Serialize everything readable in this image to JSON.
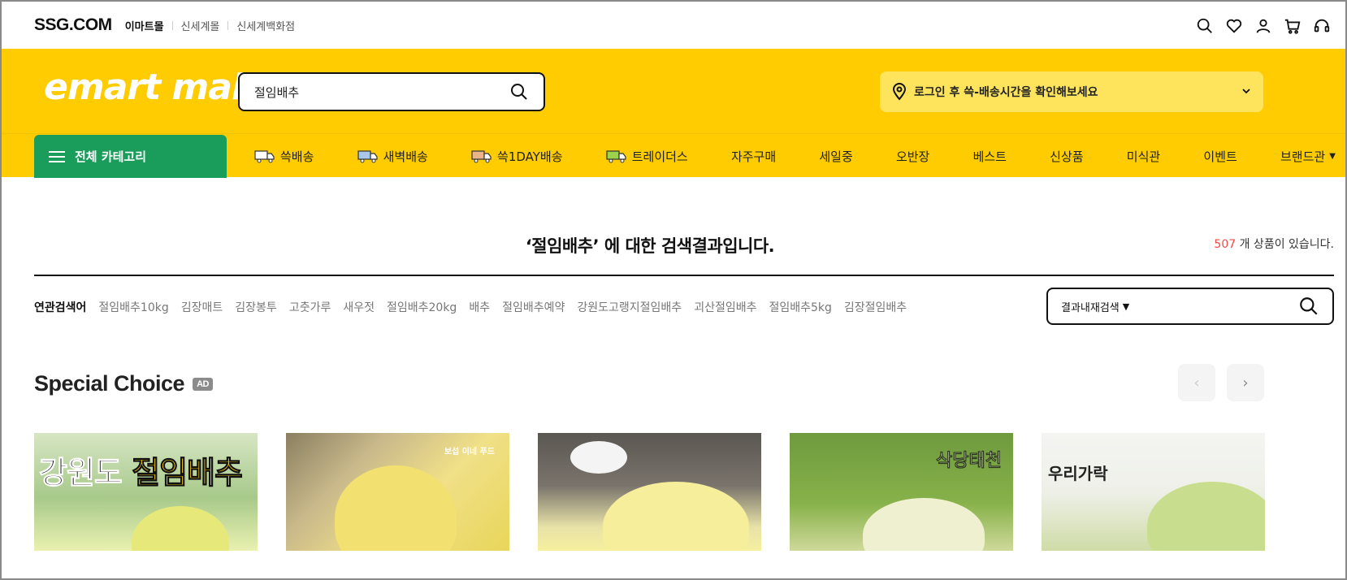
{
  "topbar": {
    "logo": "SSG.COM",
    "malls": [
      "이마트몰",
      "신세계몰",
      "신세계백화점"
    ],
    "icons": [
      "search-icon",
      "heart-icon",
      "user-icon",
      "cart-icon",
      "headset-icon"
    ]
  },
  "header": {
    "logo": "emart mall",
    "search_value": "절임배추",
    "delivery_text": "로그인 후 쓱-배송시간을 확인해보세요",
    "colors": {
      "brand_yellow": "#fecc00",
      "category_green": "#1a9c5a"
    }
  },
  "nav": {
    "all_category": "전체 카테고리",
    "items": [
      {
        "label": "쓱배송",
        "icon": "truck-white-icon"
      },
      {
        "label": "새벽배송",
        "icon": "truck-blue-icon"
      },
      {
        "label": "쓱1DAY배송",
        "icon": "truck-orange-icon"
      },
      {
        "label": "트레이더스",
        "icon": "truck-green-icon"
      },
      {
        "label": "자주구매"
      },
      {
        "label": "세일중"
      },
      {
        "label": "오반장"
      },
      {
        "label": "베스트"
      },
      {
        "label": "신상품"
      },
      {
        "label": "미식관"
      },
      {
        "label": "이벤트"
      },
      {
        "label": "브랜드관"
      }
    ]
  },
  "results": {
    "title": "‘절임배추’ 에 대한 검색결과입니다.",
    "count": "507",
    "count_suffix": " 개 상품이 있습니다."
  },
  "related": {
    "label": "연관검색어",
    "terms": [
      "절임배추10kg",
      "김장매트",
      "김장봉투",
      "고춧가루",
      "새우젓",
      "절임배추20kg",
      "배추",
      "절임배추예약",
      "강원도고랭지절임배추",
      "괴산절임배추",
      "절임배추5kg",
      "김장절임배추"
    ]
  },
  "insearch": {
    "label": "결과내재검색"
  },
  "special": {
    "title": "Special Choice",
    "badge": "AD",
    "products": [
      {
        "text_a": "강원도 ",
        "text_b": "절임배추"
      },
      {
        "text": "보섭 이네 푸드"
      },
      {
        "text": ""
      },
      {
        "text": "삭당태천"
      },
      {
        "text": "우리가락"
      }
    ]
  }
}
